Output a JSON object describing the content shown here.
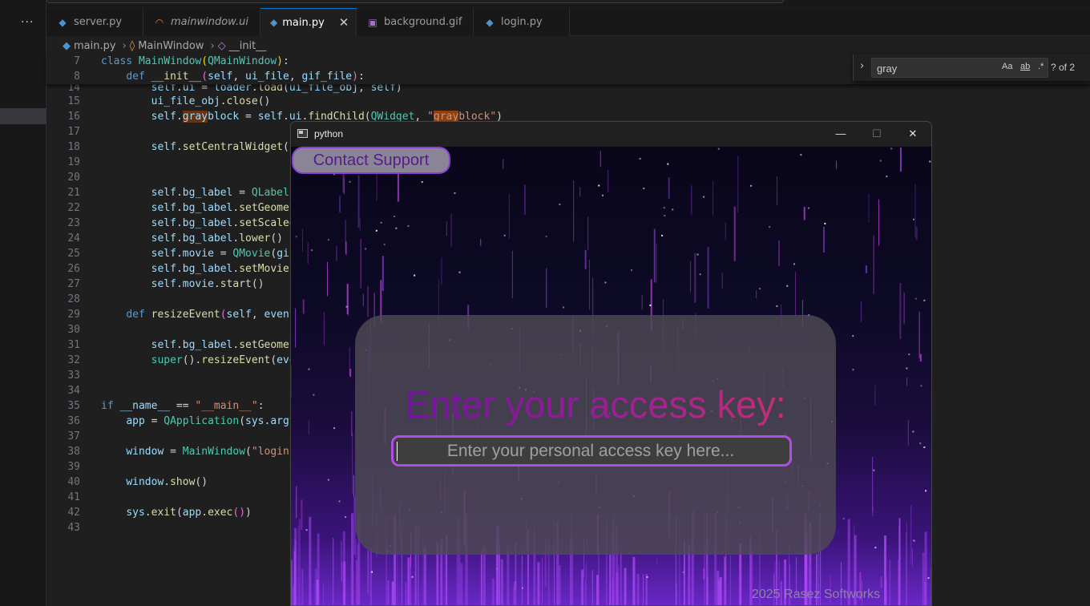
{
  "tabs": [
    {
      "label": "server.py",
      "icon": "python-file-icon"
    },
    {
      "label": "mainwindow.ui",
      "icon": "rss-icon"
    },
    {
      "label": "main.py",
      "icon": "python-file-icon",
      "active": true
    },
    {
      "label": "background.gif",
      "icon": "image-file-icon"
    },
    {
      "label": "login.py",
      "icon": "python-file-icon"
    }
  ],
  "breadcrumb": {
    "file": "main.py",
    "class": "MainWindow",
    "method": "__init__"
  },
  "find": {
    "query": "gray",
    "case_label": "Aa",
    "word_label": "ab",
    "regex_label": ".*",
    "count": "? of 2"
  },
  "code": {
    "lines": [
      {
        "n": "7"
      },
      {
        "n": "8"
      },
      {
        "n": "14"
      },
      {
        "n": "15"
      },
      {
        "n": "16"
      },
      {
        "n": "17"
      },
      {
        "n": "18"
      },
      {
        "n": "19"
      },
      {
        "n": "20"
      },
      {
        "n": "21"
      },
      {
        "n": "22"
      },
      {
        "n": "23"
      },
      {
        "n": "24"
      },
      {
        "n": "25"
      },
      {
        "n": "26"
      },
      {
        "n": "27"
      },
      {
        "n": "28"
      },
      {
        "n": "29"
      },
      {
        "n": "30"
      },
      {
        "n": "31"
      },
      {
        "n": "32"
      },
      {
        "n": "33"
      },
      {
        "n": "34"
      },
      {
        "n": "35"
      },
      {
        "n": "36"
      },
      {
        "n": "37"
      },
      {
        "n": "38"
      },
      {
        "n": "39"
      },
      {
        "n": "40"
      },
      {
        "n": "41"
      },
      {
        "n": "42"
      },
      {
        "n": "43"
      }
    ]
  },
  "python_window": {
    "title": "python",
    "minimize": "—",
    "maximize": "☐",
    "close": "✕",
    "support_button": "Contact Support",
    "heading": "Enter your access key:",
    "key_placeholder": "Enter your personal access key here...",
    "footer": "2025 Rasez Softworks"
  },
  "colors": {
    "accent_purple": "#b04de8",
    "heading_gradient_start": "#6a0fa4",
    "heading_gradient_end": "#d0346a",
    "editor_bg": "#1f1f1f"
  }
}
